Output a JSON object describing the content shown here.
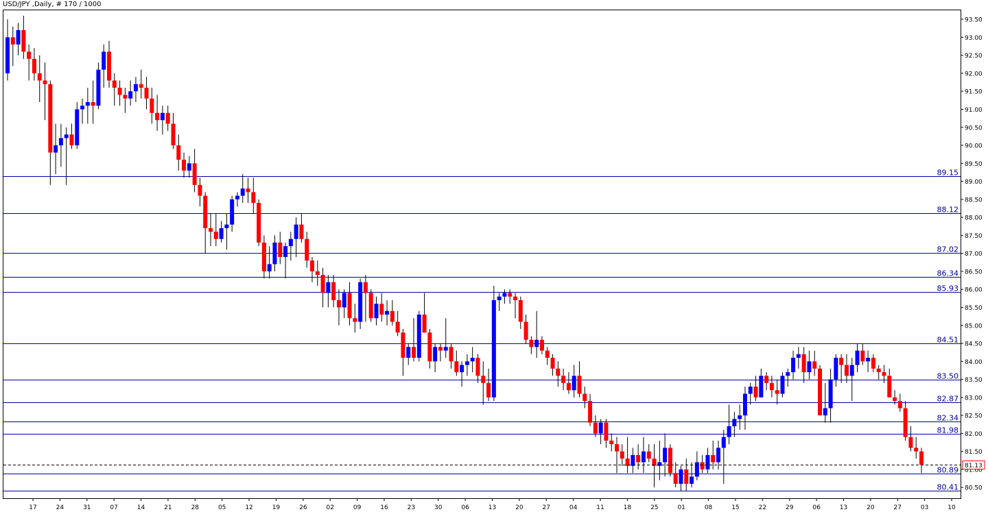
{
  "title": "USD/JPY ,Daily, # 170 / 1000",
  "chart_data": {
    "type": "candlestick",
    "ylim": [
      80.2,
      93.75
    ],
    "price_ticks": [
      "93.50",
      "93.00",
      "92.50",
      "92.00",
      "91.50",
      "91.00",
      "90.50",
      "90.00",
      "89.50",
      "89.00",
      "88.50",
      "88.00",
      "87.50",
      "87.00",
      "86.50",
      "86.00",
      "85.50",
      "85.00",
      "84.50",
      "84.00",
      "83.50",
      "83.00",
      "82.50",
      "82.00",
      "81.50",
      "81.00",
      "80.50"
    ],
    "date_ticks": [
      "17",
      "24",
      "31",
      "07",
      "14",
      "21",
      "28",
      "05",
      "12",
      "19",
      "26",
      "02",
      "09",
      "16",
      "23",
      "30",
      "06",
      "13",
      "20",
      "27",
      "04",
      "11",
      "18",
      "25",
      "01",
      "08",
      "15",
      "22",
      "29",
      "06",
      "13",
      "20",
      "27",
      "03",
      "10"
    ],
    "levels": [
      {
        "value": 89.15,
        "label": "89.15"
      },
      {
        "value": 88.12,
        "label": "88.12"
      },
      {
        "value": 87.02,
        "label": "87.02"
      },
      {
        "value": 86.34,
        "label": "86.34"
      },
      {
        "value": 85.93,
        "label": "85.93"
      },
      {
        "value": 84.51,
        "label": "84.51"
      },
      {
        "value": 83.5,
        "label": "83.50"
      },
      {
        "value": 82.87,
        "label": "82.87"
      },
      {
        "value": 82.34,
        "label": "82.34"
      },
      {
        "value": 81.98,
        "label": "81.98"
      },
      {
        "value": 80.89,
        "label": "80.89"
      },
      {
        "value": 80.41,
        "label": "80.41"
      }
    ],
    "current_price": {
      "value": 81.13,
      "label": "81.13"
    },
    "candles": [
      [
        92.0,
        93.5,
        91.8,
        93.0
      ],
      [
        93.0,
        93.3,
        92.2,
        92.8
      ],
      [
        92.8,
        93.4,
        92.5,
        93.2
      ],
      [
        93.2,
        93.6,
        92.4,
        92.6
      ],
      [
        92.6,
        92.8,
        91.8,
        92.4
      ],
      [
        92.4,
        92.7,
        91.8,
        92.0
      ],
      [
        92.0,
        92.5,
        91.2,
        91.8
      ],
      [
        91.8,
        92.3,
        90.7,
        91.7
      ],
      [
        91.7,
        91.8,
        88.9,
        89.8
      ],
      [
        89.8,
        90.6,
        89.2,
        90.0
      ],
      [
        90.0,
        90.6,
        89.4,
        90.2
      ],
      [
        90.2,
        90.5,
        88.9,
        90.3
      ],
      [
        90.3,
        90.6,
        89.9,
        90.0
      ],
      [
        90.0,
        91.2,
        89.9,
        91.0
      ],
      [
        91.0,
        91.3,
        90.6,
        91.1
      ],
      [
        91.1,
        91.6,
        90.6,
        91.2
      ],
      [
        91.2,
        91.8,
        90.6,
        91.1
      ],
      [
        91.1,
        92.3,
        91.0,
        92.1
      ],
      [
        92.1,
        92.8,
        91.6,
        92.6
      ],
      [
        92.6,
        92.9,
        91.6,
        91.8
      ],
      [
        91.8,
        92.0,
        91.1,
        91.6
      ],
      [
        91.6,
        91.8,
        91.1,
        91.4
      ],
      [
        91.4,
        91.6,
        90.9,
        91.3
      ],
      [
        91.3,
        91.8,
        91.1,
        91.5
      ],
      [
        91.5,
        91.9,
        91.2,
        91.7
      ],
      [
        91.7,
        92.1,
        91.3,
        91.6
      ],
      [
        91.6,
        91.9,
        91.0,
        91.3
      ],
      [
        91.3,
        91.6,
        90.6,
        90.9
      ],
      [
        90.9,
        91.4,
        90.4,
        90.7
      ],
      [
        90.7,
        91.1,
        90.3,
        90.9
      ],
      [
        90.9,
        91.1,
        90.4,
        90.6
      ],
      [
        90.6,
        90.9,
        89.9,
        90.0
      ],
      [
        90.0,
        90.3,
        89.3,
        89.6
      ],
      [
        89.6,
        89.8,
        89.1,
        89.3
      ],
      [
        89.3,
        89.7,
        89.1,
        89.5
      ],
      [
        89.5,
        89.9,
        88.7,
        88.9
      ],
      [
        88.9,
        89.1,
        88.3,
        88.6
      ],
      [
        88.6,
        88.7,
        87.0,
        87.7
      ],
      [
        87.7,
        88.1,
        87.2,
        87.6
      ],
      [
        87.6,
        88.1,
        87.2,
        87.4
      ],
      [
        87.4,
        87.9,
        87.3,
        87.7
      ],
      [
        87.7,
        88.1,
        87.1,
        87.8
      ],
      [
        87.8,
        88.6,
        87.6,
        88.5
      ],
      [
        88.5,
        88.7,
        88.3,
        88.6
      ],
      [
        88.6,
        89.2,
        88.4,
        88.8
      ],
      [
        88.8,
        89.1,
        88.4,
        88.7
      ],
      [
        88.7,
        89.1,
        88.1,
        88.4
      ],
      [
        88.4,
        88.5,
        87.2,
        87.3
      ],
      [
        87.3,
        87.5,
        86.3,
        86.5
      ],
      [
        86.5,
        87.2,
        86.3,
        86.7
      ],
      [
        86.7,
        87.5,
        86.5,
        87.3
      ],
      [
        87.3,
        87.6,
        86.7,
        86.9
      ],
      [
        86.9,
        87.3,
        86.3,
        87.2
      ],
      [
        87.2,
        87.6,
        86.8,
        87.4
      ],
      [
        87.4,
        88.0,
        86.9,
        87.8
      ],
      [
        87.8,
        88.1,
        87.3,
        87.4
      ],
      [
        87.4,
        87.6,
        86.6,
        86.8
      ],
      [
        86.8,
        86.9,
        86.2,
        86.5
      ],
      [
        86.5,
        86.8,
        86.1,
        86.4
      ],
      [
        86.4,
        86.6,
        85.5,
        85.9
      ],
      [
        85.9,
        86.4,
        85.5,
        86.2
      ],
      [
        86.2,
        86.4,
        85.5,
        85.7
      ],
      [
        85.7,
        86.0,
        85.0,
        85.5
      ],
      [
        85.5,
        86.0,
        85.2,
        85.9
      ],
      [
        85.9,
        86.2,
        85.0,
        85.2
      ],
      [
        85.2,
        85.6,
        84.8,
        85.1
      ],
      [
        85.1,
        86.3,
        84.9,
        86.2
      ],
      [
        86.2,
        86.4,
        85.1,
        85.9
      ],
      [
        85.9,
        86.0,
        85.1,
        85.2
      ],
      [
        85.2,
        85.8,
        85.0,
        85.6
      ],
      [
        85.6,
        85.9,
        85.1,
        85.3
      ],
      [
        85.3,
        85.7,
        85.0,
        85.4
      ],
      [
        85.4,
        85.7,
        85.0,
        85.1
      ],
      [
        85.1,
        85.4,
        84.7,
        84.8
      ],
      [
        84.8,
        84.9,
        83.6,
        84.1
      ],
      [
        84.1,
        84.5,
        83.9,
        84.4
      ],
      [
        84.4,
        85.2,
        84.0,
        84.1
      ],
      [
        84.1,
        85.4,
        84.0,
        85.3
      ],
      [
        85.3,
        85.9,
        84.8,
        84.8
      ],
      [
        84.8,
        84.9,
        83.8,
        84.0
      ],
      [
        84.0,
        84.5,
        83.7,
        84.4
      ],
      [
        84.4,
        84.5,
        84.0,
        84.3
      ],
      [
        84.3,
        85.2,
        84.1,
        84.4
      ],
      [
        84.4,
        84.5,
        83.8,
        84.0
      ],
      [
        84.0,
        84.3,
        83.6,
        83.7
      ],
      [
        83.7,
        84.0,
        83.3,
        83.9
      ],
      [
        83.9,
        84.2,
        83.6,
        84.0
      ],
      [
        84.0,
        84.4,
        83.7,
        84.1
      ],
      [
        84.1,
        84.2,
        83.4,
        83.6
      ],
      [
        83.6,
        84.0,
        82.8,
        83.4
      ],
      [
        83.4,
        83.8,
        82.9,
        83.0
      ],
      [
        83.0,
        86.1,
        82.9,
        85.7
      ],
      [
        85.7,
        85.9,
        85.4,
        85.8
      ],
      [
        85.8,
        86.0,
        85.6,
        85.9
      ],
      [
        85.9,
        86.0,
        85.6,
        85.8
      ],
      [
        85.8,
        85.9,
        85.2,
        85.7
      ],
      [
        85.7,
        85.8,
        84.9,
        85.1
      ],
      [
        85.1,
        85.3,
        84.5,
        84.6
      ],
      [
        84.6,
        84.7,
        84.2,
        84.4
      ],
      [
        84.4,
        85.4,
        84.1,
        84.6
      ],
      [
        84.6,
        84.7,
        84.2,
        84.3
      ],
      [
        84.3,
        84.4,
        83.9,
        84.1
      ],
      [
        84.1,
        84.2,
        83.6,
        83.8
      ],
      [
        83.8,
        84.0,
        83.3,
        83.6
      ],
      [
        83.6,
        83.8,
        83.2,
        83.4
      ],
      [
        83.4,
        83.7,
        83.1,
        83.2
      ],
      [
        83.2,
        83.9,
        83.0,
        83.6
      ],
      [
        83.6,
        84.0,
        83.0,
        83.1
      ],
      [
        83.1,
        83.3,
        82.7,
        82.9
      ],
      [
        82.9,
        83.1,
        82.2,
        82.3
      ],
      [
        82.3,
        82.5,
        81.9,
        82.0
      ],
      [
        82.0,
        82.4,
        81.7,
        82.3
      ],
      [
        82.3,
        82.4,
        81.6,
        81.8
      ],
      [
        81.8,
        82.0,
        81.5,
        81.7
      ],
      [
        81.7,
        81.9,
        80.9,
        81.5
      ],
      [
        81.5,
        81.7,
        81.1,
        81.3
      ],
      [
        81.3,
        81.9,
        80.9,
        81.1
      ],
      [
        81.1,
        81.6,
        80.9,
        81.4
      ],
      [
        81.4,
        81.7,
        81.0,
        81.2
      ],
      [
        81.2,
        81.9,
        80.9,
        81.5
      ],
      [
        81.5,
        81.7,
        81.2,
        81.3
      ],
      [
        81.3,
        81.7,
        80.5,
        81.1
      ],
      [
        81.1,
        81.8,
        80.7,
        81.2
      ],
      [
        81.2,
        82.0,
        80.8,
        81.6
      ],
      [
        81.6,
        81.7,
        80.8,
        80.9
      ],
      [
        80.9,
        81.2,
        80.5,
        80.6
      ],
      [
        80.6,
        81.1,
        80.4,
        81.0
      ],
      [
        81.0,
        81.3,
        80.4,
        80.6
      ],
      [
        80.6,
        81.2,
        80.5,
        80.8
      ],
      [
        80.8,
        81.5,
        80.7,
        81.2
      ],
      [
        81.2,
        81.4,
        80.9,
        81.0
      ],
      [
        81.0,
        81.6,
        80.9,
        81.4
      ],
      [
        81.4,
        81.8,
        81.0,
        81.2
      ],
      [
        81.2,
        81.8,
        81.0,
        81.6
      ],
      [
        81.6,
        82.1,
        80.6,
        81.9
      ],
      [
        81.9,
        82.8,
        81.7,
        82.2
      ],
      [
        82.2,
        82.6,
        81.9,
        82.4
      ],
      [
        82.4,
        82.8,
        82.1,
        82.5
      ],
      [
        82.5,
        83.3,
        82.1,
        83.1
      ],
      [
        83.1,
        83.4,
        82.8,
        83.3
      ],
      [
        83.3,
        83.6,
        82.9,
        83.0
      ],
      [
        83.0,
        83.8,
        83.0,
        83.6
      ],
      [
        83.6,
        83.7,
        83.2,
        83.4
      ],
      [
        83.4,
        83.6,
        83.0,
        83.2
      ],
      [
        83.2,
        83.5,
        82.8,
        83.1
      ],
      [
        83.1,
        83.7,
        83.0,
        83.6
      ],
      [
        83.6,
        83.8,
        83.3,
        83.7
      ],
      [
        83.7,
        84.3,
        83.5,
        84.1
      ],
      [
        84.1,
        84.4,
        83.8,
        84.2
      ],
      [
        84.2,
        84.4,
        83.4,
        83.7
      ],
      [
        83.7,
        84.3,
        83.5,
        84.0
      ],
      [
        84.0,
        84.3,
        83.6,
        83.8
      ],
      [
        83.8,
        83.9,
        82.5,
        82.5
      ],
      [
        82.5,
        83.4,
        82.3,
        82.7
      ],
      [
        82.7,
        83.8,
        82.3,
        83.5
      ],
      [
        83.5,
        84.2,
        83.3,
        84.1
      ],
      [
        84.1,
        84.2,
        83.4,
        83.9
      ],
      [
        83.9,
        84.2,
        83.4,
        83.6
      ],
      [
        83.6,
        84.1,
        82.9,
        83.9
      ],
      [
        83.9,
        84.5,
        83.7,
        84.3
      ],
      [
        84.3,
        84.5,
        83.9,
        84.0
      ],
      [
        84.0,
        84.3,
        83.7,
        84.1
      ],
      [
        84.1,
        84.2,
        83.7,
        83.8
      ],
      [
        83.8,
        83.9,
        83.5,
        83.7
      ],
      [
        83.7,
        83.9,
        83.4,
        83.6
      ],
      [
        83.6,
        83.8,
        83.0,
        83.0
      ],
      [
        83.0,
        83.2,
        82.8,
        82.9
      ],
      [
        82.9,
        83.1,
        82.6,
        82.7
      ],
      [
        82.7,
        82.9,
        81.8,
        81.9
      ],
      [
        81.9,
        82.2,
        81.5,
        81.6
      ],
      [
        81.6,
        81.9,
        81.3,
        81.5
      ],
      [
        81.5,
        81.6,
        80.9,
        81.13
      ]
    ]
  }
}
